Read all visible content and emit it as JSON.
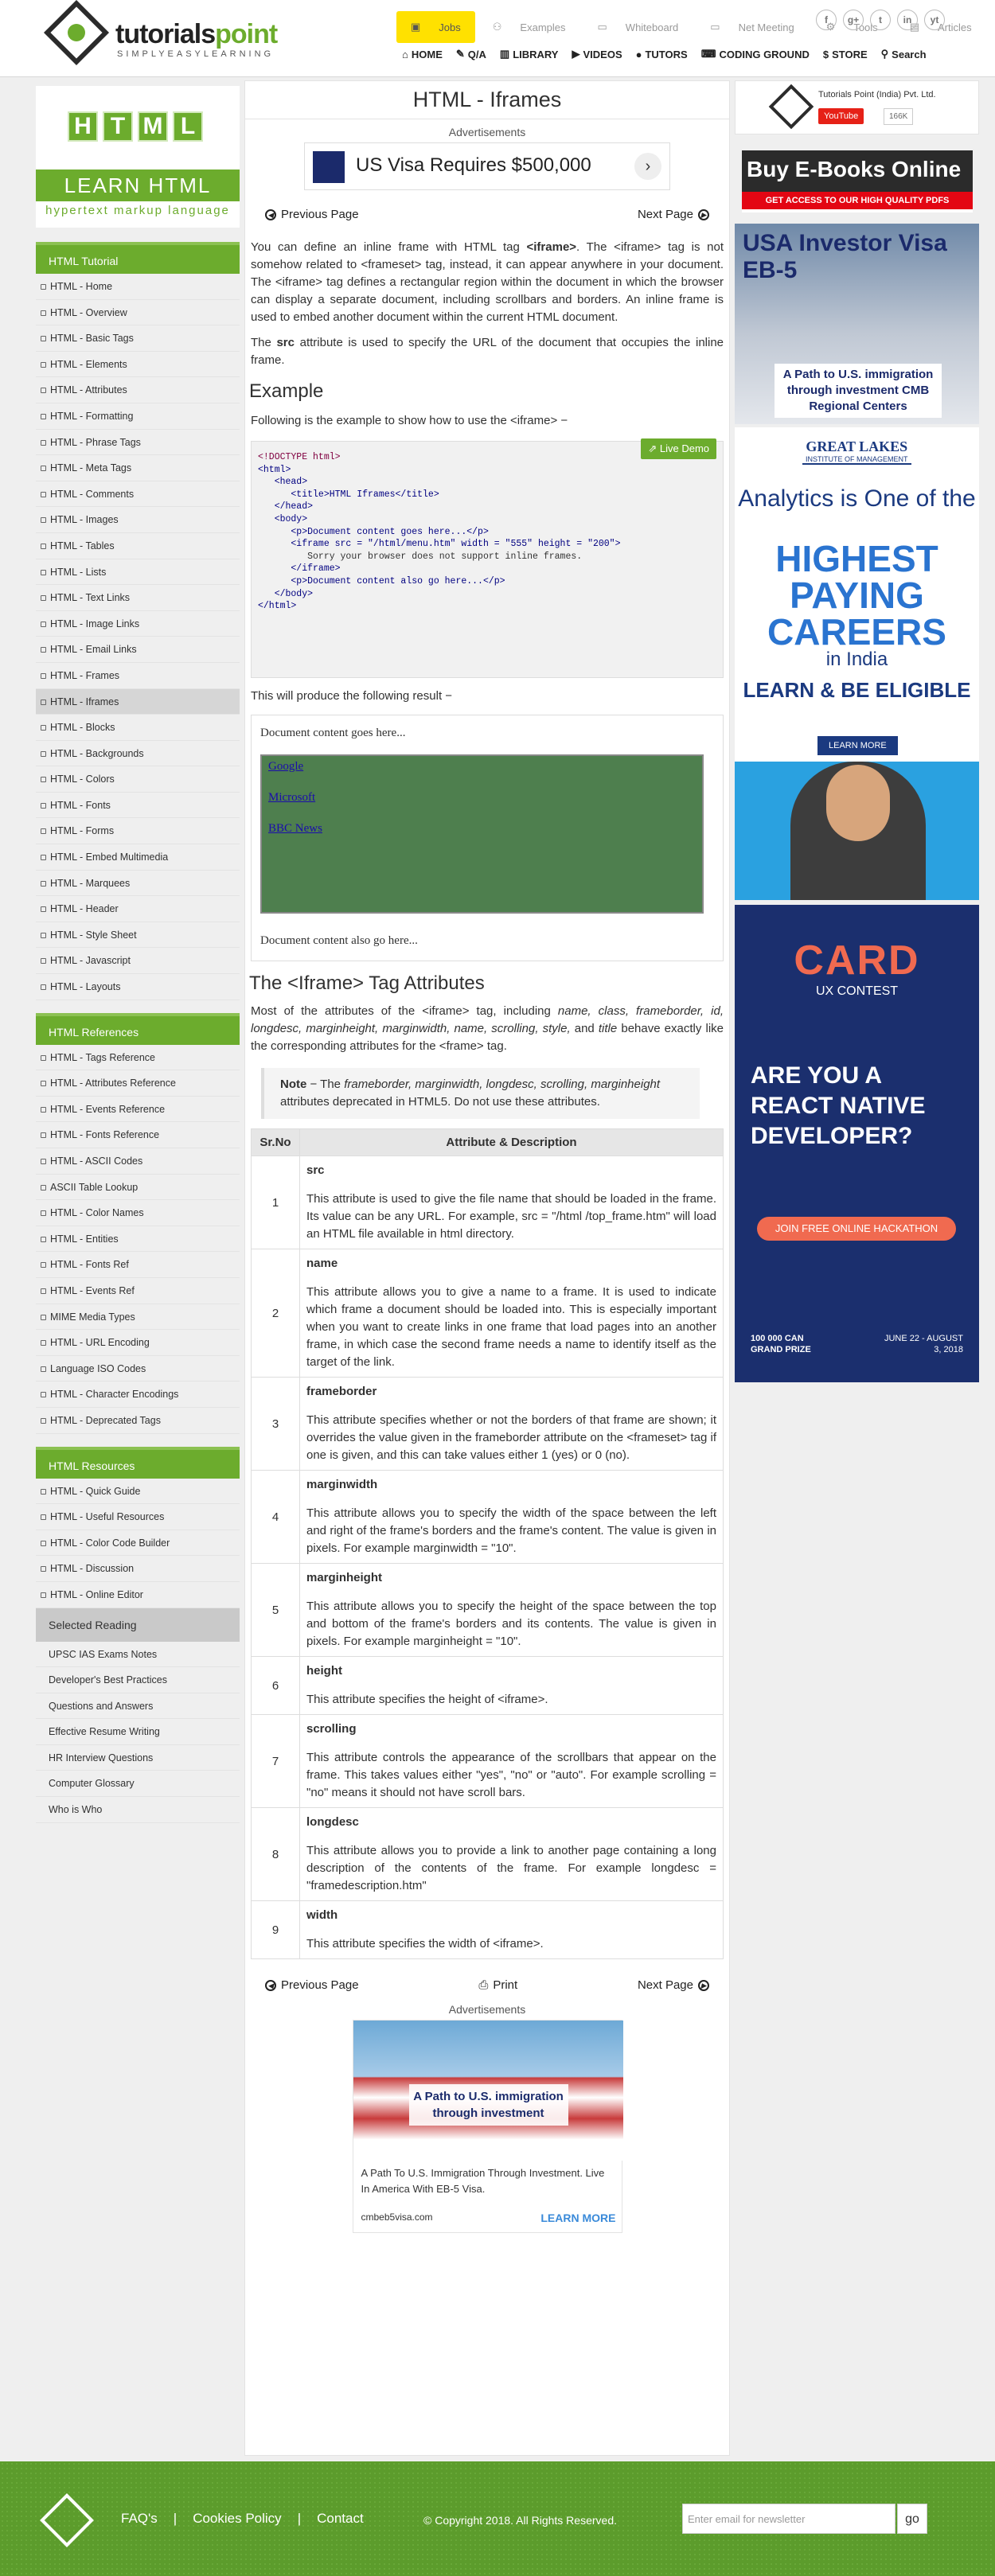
{
  "header": {
    "brand_prefix": "tutorials",
    "brand_suffix": "point",
    "tagline": "SIMPLYEASYLEARNING",
    "top_links": [
      "Jobs",
      "Examples",
      "Whiteboard",
      "Net Meeting",
      "Tools",
      "Articles"
    ],
    "social": [
      "f",
      "g+",
      "t",
      "in",
      "yt"
    ],
    "main_nav": [
      "HOME",
      "Q/A",
      "LIBRARY",
      "VIDEOS",
      "TUTORS",
      "CODING GROUND",
      "STORE",
      "Search"
    ]
  },
  "sidebar": {
    "html_letters": [
      "H",
      "T",
      "M",
      "L"
    ],
    "learn": "LEARN HTML",
    "learn_sub": "hypertext markup language",
    "tutorial_title": "HTML Tutorial",
    "tutorial_items": [
      "HTML - Home",
      "HTML - Overview",
      "HTML - Basic Tags",
      "HTML - Elements",
      "HTML - Attributes",
      "HTML - Formatting",
      "HTML - Phrase Tags",
      "HTML - Meta Tags",
      "HTML - Comments",
      "HTML - Images",
      "HTML - Tables",
      "HTML - Lists",
      "HTML - Text Links",
      "HTML - Image Links",
      "HTML - Email Links",
      "HTML - Frames",
      "HTML - Iframes",
      "HTML - Blocks",
      "HTML - Backgrounds",
      "HTML - Colors",
      "HTML - Fonts",
      "HTML - Forms",
      "HTML - Embed Multimedia",
      "HTML - Marquees",
      "HTML - Header",
      "HTML - Style Sheet",
      "HTML - Javascript",
      "HTML - Layouts"
    ],
    "active_item": "HTML - Iframes",
    "references_title": "HTML References",
    "references_items": [
      "HTML - Tags Reference",
      "HTML - Attributes Reference",
      "HTML - Events Reference",
      "HTML - Fonts Reference",
      "HTML - ASCII Codes",
      "ASCII Table Lookup",
      "HTML - Color Names",
      "HTML - Entities",
      "HTML - Fonts Ref",
      "HTML - Events Ref",
      "MIME Media Types",
      "HTML - URL Encoding",
      "Language ISO Codes",
      "HTML - Character Encodings",
      "HTML - Deprecated Tags"
    ],
    "resources_title": "HTML Resources",
    "resources_items": [
      "HTML - Quick Guide",
      "HTML - Useful Resources",
      "HTML - Color Code Builder",
      "HTML - Discussion",
      "HTML - Online Editor"
    ],
    "reading_title": "Selected Reading",
    "reading_items": [
      "UPSC IAS Exams Notes",
      "Developer's Best Practices",
      "Questions and Answers",
      "Effective Resume Writing",
      "HR Interview Questions",
      "Computer Glossary",
      "Who is Who"
    ]
  },
  "content": {
    "title": "HTML - Iframes",
    "ads_label": "Advertisements",
    "top_ad_text": "US Visa Requires $500,000",
    "prev": "Previous Page",
    "next": "Next Page",
    "intro_1a": "You can define an inline frame with HTML tag ",
    "intro_1b": "<iframe>",
    "intro_1c": ". The <iframe> tag is not somehow related to <frameset> tag, instead, it can appear anywhere in your document. The <iframe> tag defines a rectangular region within the document in which the browser can display a separate document, including scrollbars and borders. An inline frame is used to embed another document within the current HTML document.",
    "intro_2a": "The ",
    "intro_2b": "src",
    "intro_2c": " attribute is used to specify the URL of the document that occupies the inline frame.",
    "example_heading": "Example",
    "example_text": "Following is the example to show how to use the <iframe> −",
    "live_demo": "Live Demo",
    "code_lines": [
      "<!DOCTYPE html>",
      "<html>",
      "",
      "   <head>",
      "      <title>HTML Iframes</title>",
      "   </head>",
      "",
      "   <body>",
      "      <p>Document content goes here...</p>",
      "",
      "      <iframe src = \"/html/menu.htm\" width = \"555\" height = \"200\">",
      "         Sorry your browser does not support inline frames.",
      "      </iframe>",
      "",
      "      <p>Document content also go here...</p>",
      "   </body>",
      "",
      "</html>"
    ],
    "result_text": "This will produce the following result −",
    "demo_top": "Document content goes here...",
    "demo_links": [
      "Google",
      "Microsoft",
      "BBC News"
    ],
    "demo_bottom": "Document content also go here...",
    "attr_heading": "The <Iframe> Tag Attributes",
    "attr_intro_a": "Most of the attributes of the <iframe> tag, including ",
    "attr_intro_names": "name, class, frameborder, id, longdesc, marginheight, marginwidth, name, scrolling, style,",
    "attr_intro_b": " and ",
    "attr_intro_title": "title",
    "attr_intro_c": " behave exactly like the corresponding attributes for the <frame> tag.",
    "note_label": "Note",
    "note_a": " − The ",
    "note_attrs": "frameborder, marginwidth, longdesc, scrolling, marginheight",
    "note_b": " attributes deprecated in HTML5. Do not use these attributes.",
    "table_headers": [
      "Sr.No",
      "Attribute & Description"
    ],
    "table_rows": [
      {
        "no": "1",
        "name": "src",
        "desc": "This attribute is used to give the file name that should be loaded in the frame. Its value can be any URL. For example, src = \"/html /top_frame.htm\" will load an HTML file available in html directory."
      },
      {
        "no": "2",
        "name": "name",
        "desc": "This attribute allows you to give a name to a frame. It is used to indicate which frame a document should be loaded into. This is especially important when you want to create links in one frame that load pages into an another frame, in which case the second frame needs a name to identify itself as the target of the link."
      },
      {
        "no": "3",
        "name": "frameborder",
        "desc": "This attribute specifies whether or not the borders of that frame are shown; it overrides the value given in the frameborder attribute on the <frameset> tag if one is given, and this can take values either 1 (yes) or 0 (no)."
      },
      {
        "no": "4",
        "name": "marginwidth",
        "desc": "This attribute allows you to specify the width of the space between the left and right of the frame's borders and the frame's content. The value is given in pixels. For example marginwidth = \"10\"."
      },
      {
        "no": "5",
        "name": "marginheight",
        "desc": "This attribute allows you to specify the height of the space between the top and bottom of the frame's borders and its contents. The value is given in pixels. For example marginheight = \"10\"."
      },
      {
        "no": "6",
        "name": "height",
        "desc": "This attribute specifies the height of <iframe>."
      },
      {
        "no": "7",
        "name": "scrolling",
        "desc": "This attribute controls the appearance of the scrollbars that appear on the frame. This takes values either \"yes\", \"no\" or \"auto\". For example scrolling = \"no\" means it should not have scroll bars."
      },
      {
        "no": "8",
        "name": "longdesc",
        "desc": "This attribute allows you to provide a link to another page containing a long description of the contents of the frame. For example longdesc = \"framedescription.htm\""
      },
      {
        "no": "9",
        "name": "width",
        "desc": "This attribute specifies the width of <iframe>."
      }
    ],
    "print": "Print",
    "bottom_ad_caption": "A Path to U.S. immigration through investment",
    "bottom_ad_text": "A Path To U.S. Immigration Through Investment. Live In America With EB-5 Visa.",
    "bottom_ad_site": "cmbeb5visa.com",
    "bottom_ad_cta": "LEARN MORE"
  },
  "right": {
    "company": "Tutorials Point (India) Pvt. Ltd.",
    "youtube": "YouTube",
    "yt_count": "166K",
    "ebook_title": "Buy E-Books Online",
    "ebook_sub": "GET ACCESS TO OUR HIGH QUALITY PDFS",
    "eb5_title": "USA Investor Visa EB-5",
    "eb5_box": "A Path to U.S. immigration through investment CMB Regional Centers",
    "gl_logo": "GREAT LAKES",
    "gl_logo_sub": "INSTITUTE OF MANAGEMENT",
    "gl_a1": "Analytics is One of the",
    "gl_a2": "HIGHEST PAYING CAREERS",
    "gl_a3": "in India",
    "gl_a4": "LEARN & BE ELIGIBLE",
    "gl_btn": "LEARN MORE",
    "card_title": "CARD",
    "card_sub": "UX CONTEST",
    "card_q": "ARE YOU A REACT NATIVE DEVELOPER?",
    "card_btn": "JOIN FREE ONLINE HACKATHON",
    "card_prize": "100 000 CAN GRAND PRIZE",
    "card_dates": "JUNE 22 - AUGUST 3, 2018"
  },
  "footer": {
    "links": [
      "FAQ's",
      "Cookies Policy",
      "Contact"
    ],
    "copyright": "© Copyright 2018. All Rights Reserved.",
    "newsletter_placeholder": "Enter email for newsletter",
    "go": "go"
  }
}
